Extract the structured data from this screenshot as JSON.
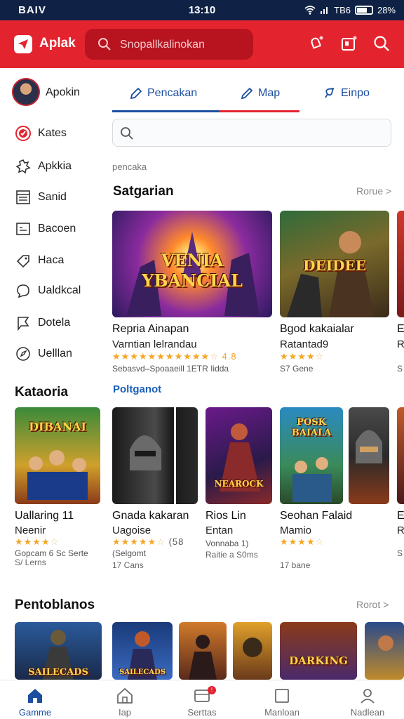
{
  "status_bar": {
    "carrier": "BAIV",
    "time": "13:10",
    "right_text": "TB6",
    "battery_text": "28%"
  },
  "header": {
    "app_name": "Aplak",
    "search_placeholder": "Snopallkalinokan"
  },
  "profile": {
    "name": "Apokin"
  },
  "sidebar": {
    "items": [
      {
        "label": "Kates",
        "icon": "target-icon"
      },
      {
        "label": "Apkkia",
        "icon": "puzzle-icon"
      },
      {
        "label": "Sanid",
        "icon": "calendar-grid-icon"
      },
      {
        "label": "Bacoen",
        "icon": "image-frame-icon"
      },
      {
        "label": "Haca",
        "icon": "tag-icon"
      },
      {
        "label": "Ualdkcal",
        "icon": "chat-bubble-icon"
      },
      {
        "label": "Dotela",
        "icon": "flag-icon"
      },
      {
        "label": "Uelllan",
        "icon": "compass-icon"
      }
    ]
  },
  "tabs": [
    {
      "label": "Pencakan",
      "icon": "pencil-icon"
    },
    {
      "label": "Map",
      "icon": "edit-icon"
    },
    {
      "label": "Einpo",
      "icon": "pin-icon"
    }
  ],
  "breadcrumb": "pencaka",
  "featured": {
    "title": "Satgarian",
    "more": "Rorue >",
    "cards": [
      {
        "art": "VENIA YBANCIAL",
        "name": "Repria Ainapan",
        "sub": "Varntian lelrandau",
        "rating": 4.5,
        "rating_text": "4.8",
        "meta": "Sebasvd–Spoaaeill 1ETR Iidda"
      },
      {
        "art": "DEIDEE",
        "name": "Bgod kakaialar",
        "sub": "Ratantad9",
        "rating": 4,
        "rating_text": "",
        "meta": "S7 Gene"
      },
      {
        "art": "",
        "name": "E",
        "sub": "R",
        "rating": 1,
        "rating_text": "",
        "meta": "S"
      }
    ]
  },
  "kategoria": {
    "title": "Kataoria",
    "sub_link": "Poltganot",
    "cards": [
      {
        "art": "DIBANAI",
        "name": "Uallaring 11",
        "sub": "Neenir",
        "rating": 4,
        "rating_text": "",
        "meta": "Gopcam 6 Sc Serte",
        "meta2": "S/ Lerns"
      },
      {
        "art": "",
        "name": "Gnada kakaran",
        "sub": "Uagoise",
        "rating": 4,
        "rating_text": "(58",
        "meta": "(Selgomt",
        "meta2": "17 Cans"
      },
      {
        "art": "NEAROCK",
        "name": "Rios Lin",
        "sub": "Entan",
        "rating": 0,
        "rating_text": "",
        "meta": "Vonnaba 1)",
        "meta2": "Raitie a S0ms"
      },
      {
        "art": "POSK BAIALA",
        "name": "Seohan Falaid",
        "sub": "Mamio",
        "rating": 4,
        "rating_text": "",
        "meta": "",
        "meta2": "17 bane"
      },
      {
        "art": "",
        "name": "E",
        "sub": "R",
        "rating": 1,
        "rating_text": "",
        "meta": "S",
        "meta2": ""
      }
    ]
  },
  "popular": {
    "title": "Pentoblanos",
    "more": "Rorot >",
    "cards": [
      {
        "art": "SAILECADS"
      },
      {
        "art": "SAILECADS"
      },
      {
        "art": ""
      },
      {
        "art": ""
      },
      {
        "art": "DARKING"
      },
      {
        "art": ""
      }
    ]
  },
  "bottom_nav": [
    {
      "label": "Gamme",
      "icon": "home-icon",
      "active": true
    },
    {
      "label": "Iap",
      "icon": "house-outline-icon",
      "active": false
    },
    {
      "label": "Serttas",
      "icon": "inbox-icon",
      "active": false,
      "badge": "!"
    },
    {
      "label": "Manloan",
      "icon": "square-icon",
      "active": false
    },
    {
      "label": "Nadlean",
      "icon": "person-icon",
      "active": false
    }
  ],
  "colors": {
    "brand_red": "#e3242f",
    "status_bar": "#0f2246",
    "accent_blue": "#1b4fa0",
    "star": "#f5a623"
  }
}
